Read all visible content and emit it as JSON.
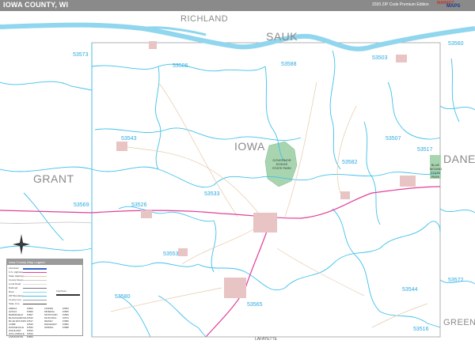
{
  "header": {
    "title": "IOWA COUNTY, WI",
    "edition": "2020 ZIP Code Premium Edition",
    "brand_top": "MARKET",
    "brand_bottom": "MAPS",
    "bg_color": "#8a8a8a"
  },
  "counties": {
    "main": "IOWA",
    "neighbors": [
      "RICHLAND",
      "SAUK",
      "GRANT",
      "DANE",
      "GREEN",
      "LAFAYETTE"
    ]
  },
  "zip_codes": [
    "53573",
    "53506",
    "53588",
    "53503",
    "53560",
    "53543",
    "53507",
    "53582",
    "53517",
    "53533",
    "53569",
    "53526",
    "53553",
    "53580",
    "53565",
    "53544",
    "53572",
    "53516"
  ],
  "parks": {
    "governor_dodge": "GOVERNOR DODGE STATE PARK",
    "blue_mound": "BLUE MOUND STATE PARK"
  },
  "colors": {
    "zip_boundary": "#3fc1ea",
    "highway": "#e0409a",
    "road": "#e8c9a8",
    "water": "#8fd6ee",
    "park": "#a8d5b0",
    "urban": "#e8c4c4",
    "county_line": "#a0a0a0"
  },
  "legend": {
    "title": "Iowa County Map Legend",
    "items": [
      "Interstate",
      "U.S. Highway",
      "State Highway",
      "County Road",
      "Local Road",
      "Railroad",
      "River",
      "ZIP Boundary",
      "County Line",
      "State Line",
      "City/Town"
    ],
    "cities": [
      [
        "ARENA",
        "53503",
        "LINDEN",
        "53553"
      ],
      [
        "AVOCA",
        "53506",
        "MINERAL POINT",
        "53565"
      ],
      [
        "BARNEVELD",
        "53507",
        "MONTFORT",
        "53569"
      ],
      [
        "BLANCHARDVILLE",
        "53516",
        "MUSCODA",
        "53573"
      ],
      [
        "BLUE MOUNDS",
        "53517",
        "REWEY",
        "53580"
      ],
      [
        "COBB",
        "53526",
        "RIDGEWAY",
        "53582"
      ],
      [
        "DODGEVILLE",
        "53533",
        "SPRING GREEN",
        "53588"
      ],
      [
        "HIGHLAND",
        "53543",
        "",
        ""
      ],
      [
        "HOLLANDALE",
        "53544",
        "",
        ""
      ],
      [
        "LIVINGSTON",
        "53554",
        "",
        ""
      ]
    ]
  }
}
